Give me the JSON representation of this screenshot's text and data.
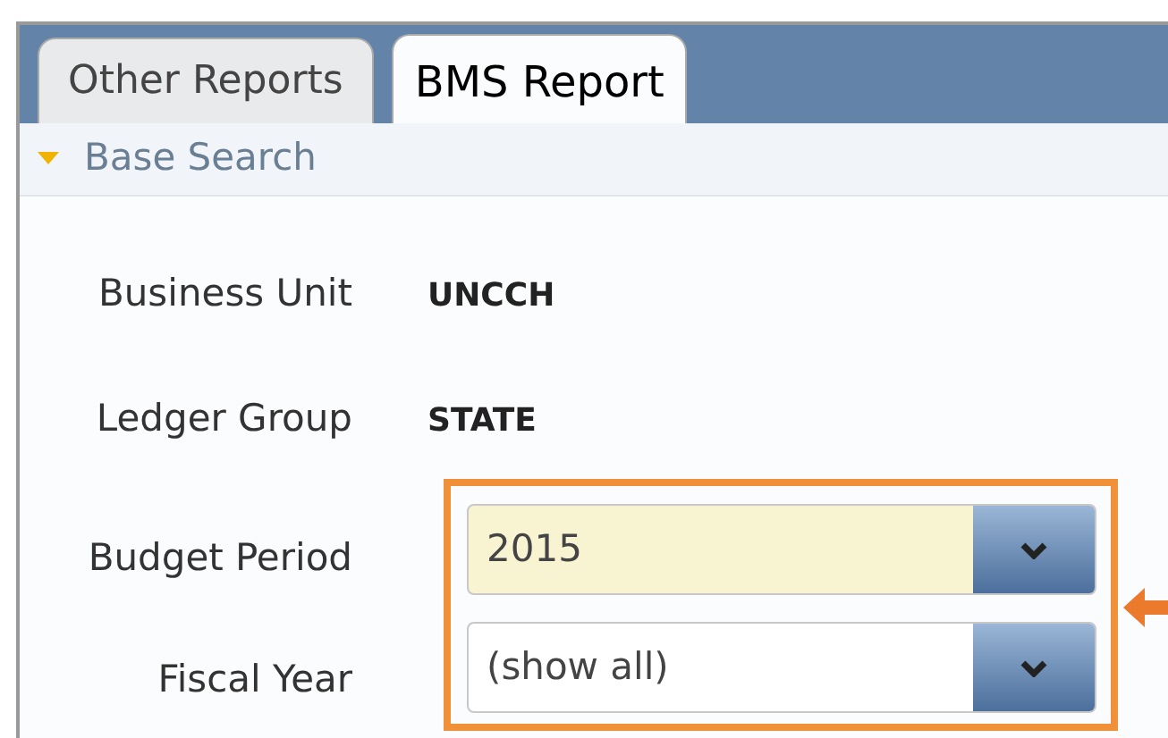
{
  "tabs": [
    {
      "label": "Other Reports",
      "selected": false
    },
    {
      "label": "BMS Report",
      "selected": true
    }
  ],
  "section": {
    "title": "Base Search",
    "expanded": true
  },
  "fields": [
    {
      "kind": "text",
      "label": "Business Unit",
      "value": "UNCCH"
    },
    {
      "kind": "text",
      "label": "Ledger Group",
      "value": "STATE"
    },
    {
      "kind": "select",
      "label": "Budget Period",
      "value": "2015",
      "highlighted": true
    },
    {
      "kind": "select",
      "label": "Fiscal Year",
      "value": "(show all)",
      "highlighted": false
    }
  ]
}
